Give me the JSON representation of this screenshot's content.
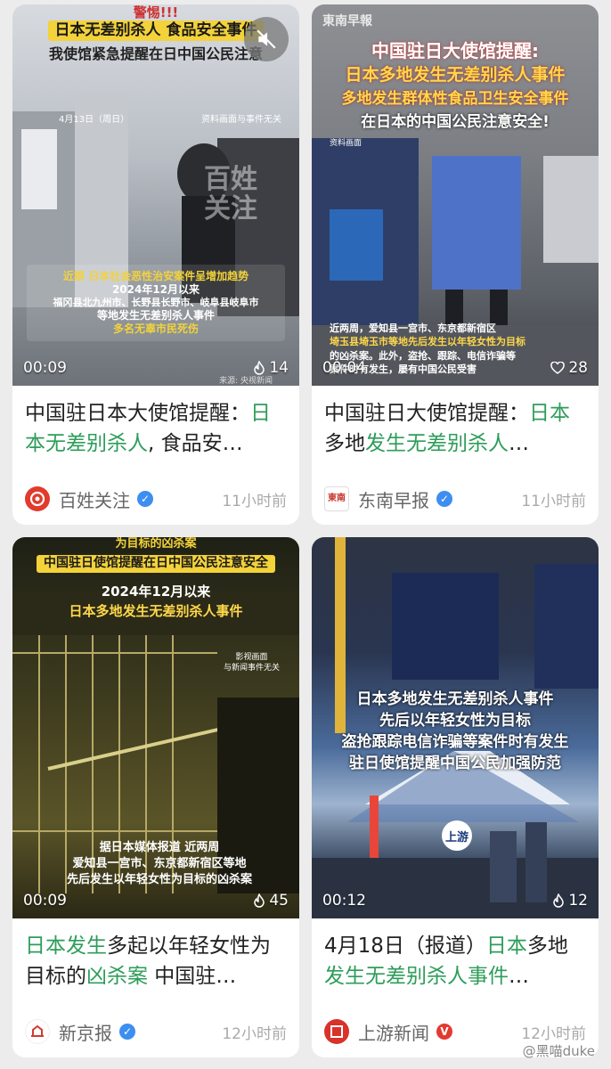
{
  "cards": [
    {
      "overlay": {
        "top_tag": "日本无差别杀人 食品安全事件",
        "top_cut": "警惕!!!",
        "subtitle": "我使馆紧急提醒在日中国公民注意",
        "date_tag": "4月13日（周日）",
        "source_note": "资料画面与事件无关",
        "wm": "百姓关注",
        "box_lines": [
          "近期 日本社会恶性治安案件呈增加趋势",
          "2024年12月以来",
          "福冈县北九州市、长野县长野市、岐阜县岐阜市",
          "等地发生无差别杀人事件",
          "多名无辜市民死伤"
        ],
        "credit": "来源: 央视新闻"
      },
      "duration": "00:09",
      "likes": "14",
      "title_segments": [
        {
          "text": "中国驻日本大使馆提醒：",
          "hl": false
        },
        {
          "text": "日本无差别杀人",
          "hl": true
        },
        {
          "text": ", 食品安…",
          "hl": false
        }
      ],
      "author": "百姓关注",
      "time": "11小时前",
      "avatar_color": "#e03b2c",
      "verify_color": "#3d8ef0"
    },
    {
      "overlay": {
        "logo": "東南早報",
        "lines": [
          "中国驻日大使馆提醒:",
          "日本多地发生无差别杀人事件",
          "多地发生群体性食品卫生安全事件",
          "在日本的中国公民注意安全!"
        ],
        "note": "资料画面",
        "bottom_lines": [
          "近两周，爱知县一宫市、东京都新宿区",
          "埼玉县埼玉市等地先后发生以年轻女性为目标",
          "的凶杀案。此外，盗抢、跟踪、电信诈骗等",
          "案件时有发生，屡有中国公民受害"
        ]
      },
      "duration": "00:04",
      "likes": "28",
      "title_segments": [
        {
          "text": "中国驻日大使馆提醒：",
          "hl": false
        },
        {
          "text": "日本",
          "hl": true
        },
        {
          "text": "多地",
          "hl": false
        },
        {
          "text": "发生无差别杀人",
          "hl": true
        },
        {
          "text": "…",
          "hl": false
        }
      ],
      "author": "东南早报",
      "time": "11小时前",
      "avatar_color": "#c8352a",
      "verify_color": "#3d8ef0"
    },
    {
      "overlay": {
        "top_cut": "为目标的凶杀案",
        "tag": "中国驻日使馆提醒在日中国公民注意安全",
        "lines": [
          "2024年12月以来",
          "日本多地发生无差别杀人事件"
        ],
        "note": [
          "影视画面",
          "与新闻事件无关"
        ],
        "bottom_lines": [
          "据日本媒体报道 近两周",
          "爱知县一宫市、东京都新宿区等地",
          "先后发生以年轻女性为目标的凶杀案"
        ]
      },
      "duration": "00:09",
      "likes": "45",
      "title_segments": [
        {
          "text": "日本发生",
          "hl": true
        },
        {
          "text": "多起以年轻女性为目标的",
          "hl": false
        },
        {
          "text": "凶杀案",
          "hl": true
        },
        {
          "text": " 中国驻…",
          "hl": false
        }
      ],
      "author": "新京报",
      "time": "12小时前",
      "avatar_color": "#d33a2f",
      "verify_color": "#3d8ef0"
    },
    {
      "overlay": {
        "lines": [
          "日本多地发生无差别杀人事件",
          "先后以年轻女性为目标",
          "盗抢跟踪电信诈骗等案件时有发生",
          "驻日使馆提醒中国公民加强防范"
        ],
        "logo": "上游"
      },
      "duration": "00:12",
      "likes": "12",
      "title_segments": [
        {
          "text": "4月18日（报道）",
          "hl": false
        },
        {
          "text": "日本",
          "hl": true
        },
        {
          "text": "多地",
          "hl": false
        },
        {
          "text": "发生无差别杀人事件",
          "hl": true
        },
        {
          "text": "…",
          "hl": false
        }
      ],
      "author": "上游新闻",
      "time": "12小时前",
      "avatar_color": "#d8322b",
      "verify_color": "#e33a2f"
    }
  ],
  "watermark": "@黑喵duke",
  "icons": {
    "mute": "mute-icon",
    "like": "flame-icon",
    "verify": "verified-icon"
  }
}
